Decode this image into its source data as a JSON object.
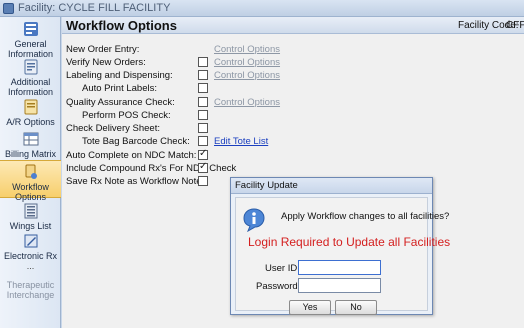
{
  "window": {
    "title": "Facility: CYCLE FILL FACILITY"
  },
  "sidebar": {
    "items": [
      {
        "label": "General Information",
        "icon": "general-information-icon",
        "active": false
      },
      {
        "label": "Additional Information",
        "icon": "additional-information-icon",
        "active": false
      },
      {
        "label": "A/R Options",
        "icon": "ar-options-icon",
        "active": false
      },
      {
        "label": "Billing Matrix",
        "icon": "billing-matrix-icon",
        "active": false
      },
      {
        "label": "Workflow Options",
        "icon": "workflow-options-icon",
        "active": true
      },
      {
        "label": "Wings List",
        "icon": "wings-list-icon",
        "active": false
      },
      {
        "label": "Electronic Rx",
        "icon": "electronic-rx-icon",
        "active": false
      },
      {
        "label": "Therapeutic Interchange",
        "icon": "",
        "active": false,
        "disabled": true
      }
    ],
    "more": "..."
  },
  "header": {
    "title": "Workflow Options",
    "facility_code_label": "Facility Code:",
    "facility_code_value": "CFF"
  },
  "options": [
    {
      "label": "New Order Entry:",
      "checkbox": false,
      "link": "Control Options",
      "link_enabled": false
    },
    {
      "label": "Verify New Orders:",
      "checkbox": true,
      "checked": false,
      "link": "Control Options",
      "link_enabled": false
    },
    {
      "label": "Labeling and Dispensing:",
      "checkbox": true,
      "checked": false,
      "link": "Control Options",
      "link_enabled": false
    },
    {
      "label": "Auto Print Labels:",
      "checkbox": true,
      "checked": false,
      "indent": true
    },
    {
      "label": "Quality Assurance Check:",
      "checkbox": true,
      "checked": false,
      "link": "Control Options",
      "link_enabled": false
    },
    {
      "label": "Perform POS Check:",
      "checkbox": true,
      "checked": false,
      "indent": true
    },
    {
      "label": "Check Delivery Sheet:",
      "checkbox": true,
      "checked": false
    },
    {
      "label": "Tote Bag Barcode Check:",
      "checkbox": true,
      "checked": false,
      "indent": true,
      "link": "Edit Tote List",
      "link_enabled": true
    },
    {
      "label": "Auto Complete on NDC Match:",
      "checkbox": true,
      "checked": true
    },
    {
      "label": "Include Compound Rx's For NDC Check",
      "checkbox": true,
      "checked": true
    },
    {
      "label": "Save Rx Note as Workflow Note:",
      "checkbox": true,
      "checked": false
    }
  ],
  "dialog": {
    "title": "Facility Update",
    "question": "Apply Workflow changes to all facilities?",
    "warning": "Login Required to Update all Facilities",
    "user_id_label": "User ID:",
    "password_label": "Password:",
    "user_id_value": "",
    "password_value": "",
    "yes_label": "Yes",
    "no_label": "No"
  },
  "colors": {
    "warning": "#d42020",
    "link_enabled": "#1b3fbf",
    "link_disabled": "#8d97a5",
    "active_sidebar": "#f7cf6c"
  }
}
